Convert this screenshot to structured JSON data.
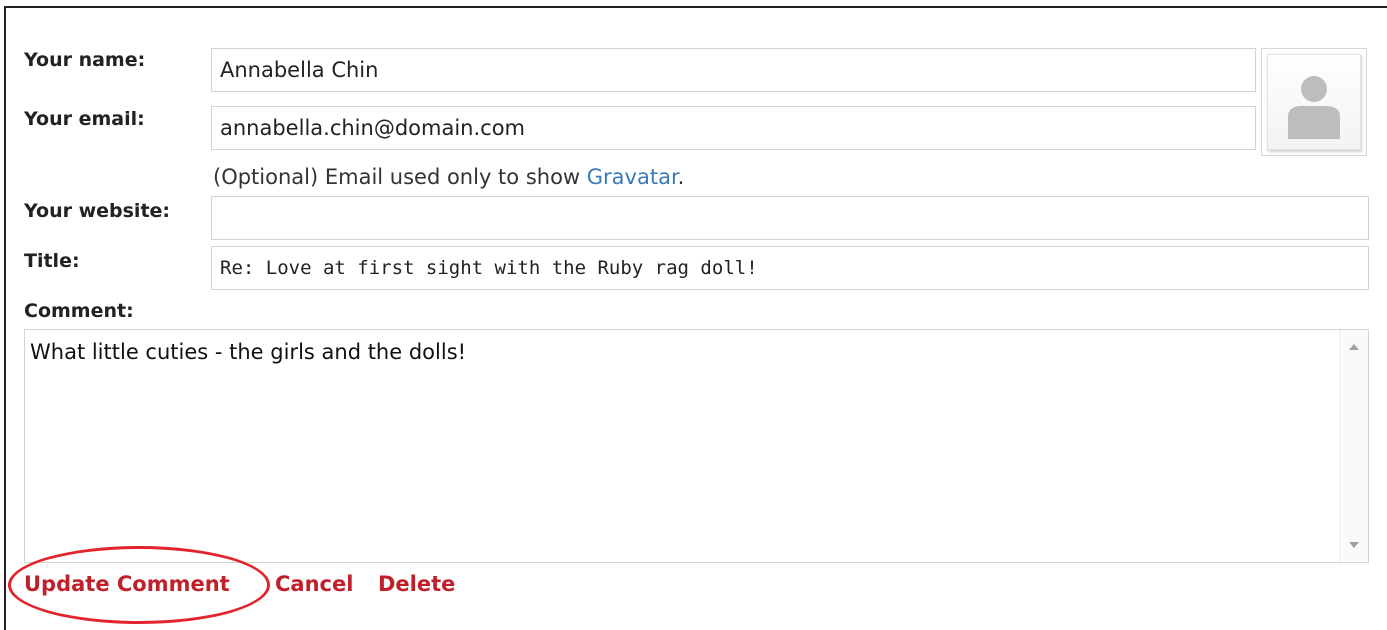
{
  "form": {
    "name_label": "Your name:",
    "name_value": "Annabella Chin",
    "email_label": "Your email:",
    "email_value": "annabella.chin@domain.com",
    "email_hint_prefix": "(Optional) Email used only to show ",
    "email_hint_link": "Gravatar",
    "email_hint_suffix": ".",
    "website_label": "Your website:",
    "website_value": "",
    "title_label": "Title:",
    "title_value": "Re: Love at first sight with the Ruby rag doll!",
    "comment_label": "Comment:",
    "comment_value": "What little cuties - the girls and the dolls!"
  },
  "avatar": {
    "icon": "default-user-avatar-icon"
  },
  "actions": {
    "update_label": "Update Comment",
    "cancel_label": "Cancel",
    "delete_label": "Delete"
  },
  "colors": {
    "action_red": "#c0202a",
    "link_blue": "#3a7ab8",
    "highlight_ring": "#e2242c"
  }
}
